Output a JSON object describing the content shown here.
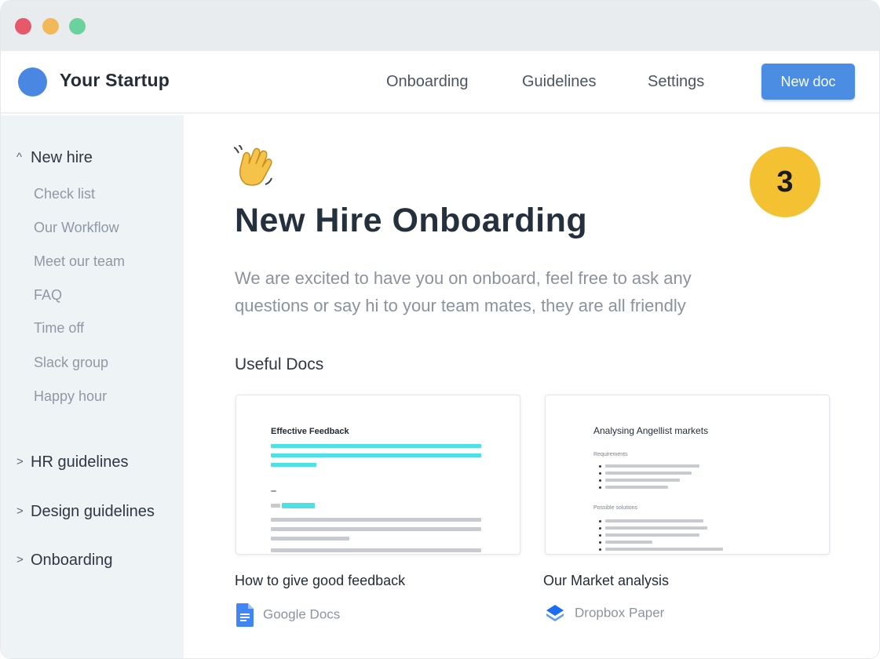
{
  "window": {
    "title": ""
  },
  "brand": {
    "name": "Your Startup",
    "logo_color": "#4a87e2"
  },
  "nav": {
    "links": [
      "Onboarding",
      "Guidelines",
      "Settings"
    ],
    "new_doc_label": "New doc",
    "accent": "#4a8de3"
  },
  "sidebar": {
    "expanded_section": "New hire",
    "sub_items": [
      "Check list",
      "Our Workflow",
      "Meet our team",
      "FAQ",
      "Time off",
      "Slack group",
      "Happy hour"
    ],
    "collapsed_sections": [
      "HR guidelines",
      "Design guidelines",
      "Onboarding"
    ]
  },
  "main": {
    "icon": "waving-hand-icon",
    "step_badge": "3",
    "step_badge_color": "#f3c131",
    "title": "New Hire Onboarding",
    "intro_line1": "We are excited to have you on onboard, feel free to ask any",
    "intro_line2": "questions or say hi to your team mates, they are all friendly",
    "useful_docs_heading": "Useful Docs",
    "docs": [
      {
        "preview_title": "Effective Feedback",
        "title": "How to give good feedback",
        "source": "Google Docs",
        "source_icon": "google-docs-icon"
      },
      {
        "preview_title": "Analysing Angellist markets",
        "preview_section_1": "Requirements",
        "preview_section_2": "Possible solutions",
        "title": "Our Market analysis",
        "source": "Dropbox Paper",
        "source_icon": "dropbox-paper-icon"
      }
    ]
  }
}
